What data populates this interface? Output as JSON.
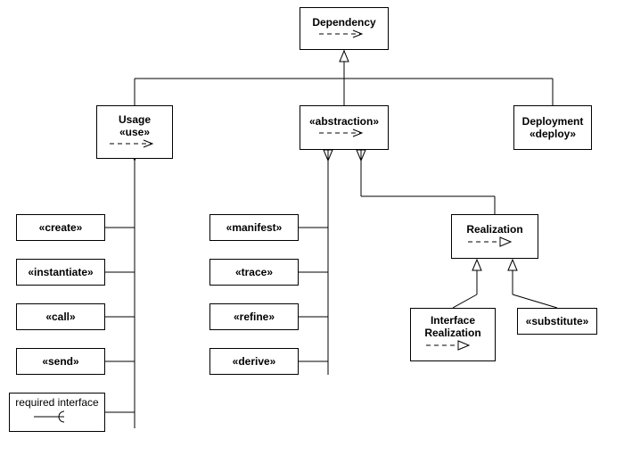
{
  "diagram": {
    "root": {
      "title": "Dependency"
    },
    "usage": {
      "title": "Usage",
      "stereo": "«use»"
    },
    "abstraction": {
      "stereo": "«abstraction»"
    },
    "deployment": {
      "title": "Deployment",
      "stereo": "«deploy»"
    },
    "realization": {
      "title": "Realization"
    },
    "interfaceRealization": {
      "title": "Interface\nRealization"
    },
    "substitute": {
      "stereo": "«substitute»"
    },
    "usageChildren": {
      "create": "«create»",
      "instantiate": "«instantiate»",
      "call": "«call»",
      "send": "«send»",
      "reqIf": "required interface"
    },
    "absChildren": {
      "manifest": "«manifest»",
      "trace": "«trace»",
      "refine": "«refine»",
      "derive": "«derive»"
    }
  }
}
